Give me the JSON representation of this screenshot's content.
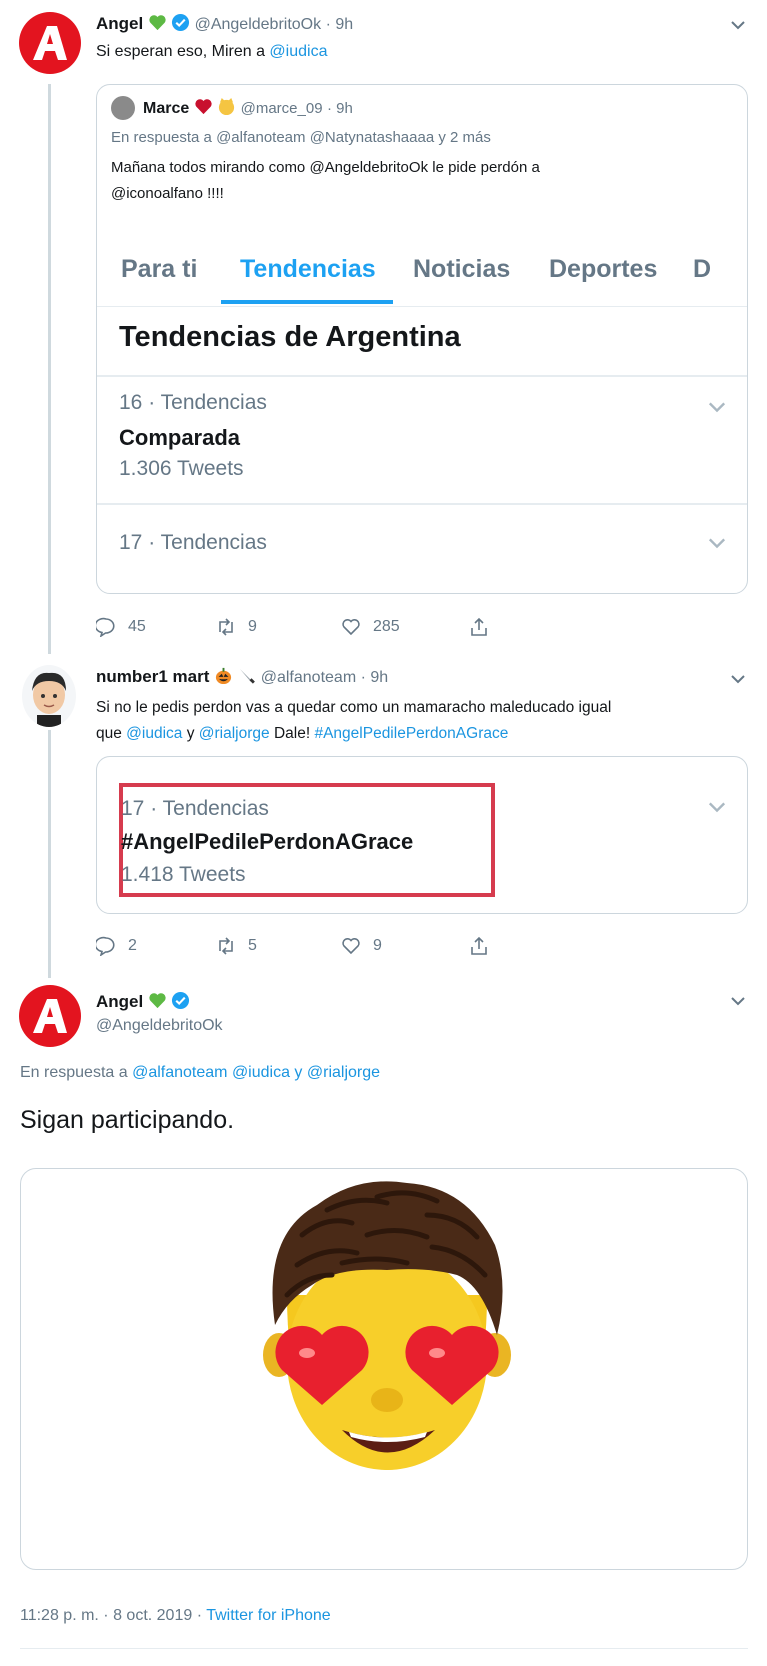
{
  "tweet1": {
    "name": "Angel",
    "handle": "@AngeldebritoOk",
    "time": "· 9h",
    "text_before": "Si esperan eso, Miren a ",
    "mention": "@iudica",
    "quote": {
      "name": "Marce",
      "handle": "@marce_09",
      "time": "· 9h",
      "reply_prefix": "En respuesta a ",
      "reply_mentions": "@alfanoteam @Natynatashaaaa",
      "reply_suffix": " y 2 más",
      "text_line1": "Mañana todos mirando  como @AngeldebritoOk  le pide perdón a",
      "text_line2": "@iconoalfano !!!!",
      "tabs": [
        "Para ti",
        "Tendencias",
        "Noticias",
        "Deportes",
        "D"
      ],
      "trends_title": "Tendencias de Argentina",
      "trend1": {
        "rank": "16 · Tendencias",
        "name": "Comparada",
        "count": "1.306 Tweets"
      },
      "trend2": {
        "rank": "17 · Tendencias"
      }
    },
    "replies": "45",
    "retweets": "9",
    "likes": "285"
  },
  "tweet2": {
    "name": "number1 mart",
    "handle": "@alfanoteam",
    "time": "· 9h",
    "text_line1": "Si no le pedis perdon vas a quedar como un mamaracho maleducado igual",
    "line2_que": "que ",
    "line2_m1": "@iudica",
    "line2_y": " y ",
    "line2_m2": "@rialjorge",
    "line2_dale": " Dale! ",
    "line2_hashtag": "#AngelPedilePerdonAGrace",
    "card": {
      "rank": "17 · Tendencias",
      "name": "#AngelPedilePerdonAGrace",
      "count": "1.418 Tweets"
    },
    "replies": "2",
    "retweets": "5",
    "likes": "9"
  },
  "tweet3": {
    "name": "Angel",
    "handle": "@AngeldebritoOk",
    "reply_prefix": "En respuesta a ",
    "reply_m1": "@alfanoteam",
    "reply_m2": "@iudica",
    "reply_y": " y ",
    "reply_m3": "@rialjorge",
    "text": "Sigan participando.",
    "timestamp": "11:28 p. m. · 8 oct. 2019 · ",
    "source": "Twitter for iPhone"
  },
  "colors": {
    "accent": "#1da1f2",
    "link": "#1b95e0",
    "brand_red": "#e3141f",
    "highlight": "#d63b4e"
  }
}
